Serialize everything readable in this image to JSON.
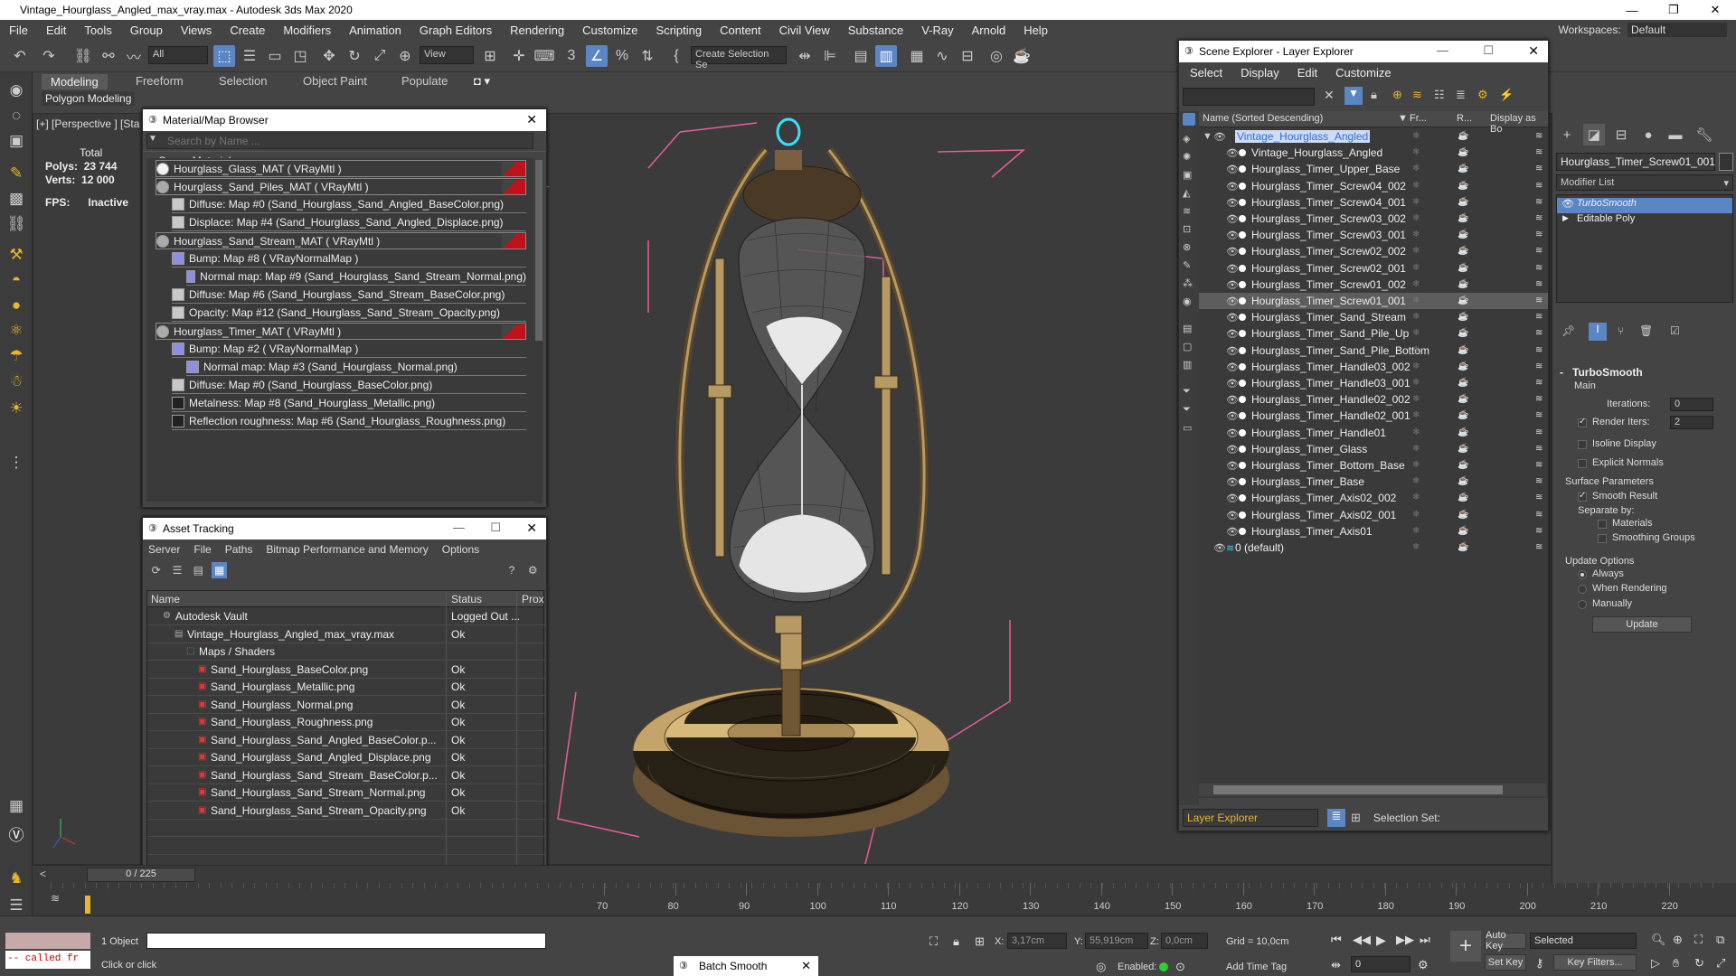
{
  "app": {
    "title": "Vintage_Hourglass_Angled_max_vray.max - Autodesk 3ds Max 2020",
    "workspaces_label": "Workspaces:",
    "workspace": "Default"
  },
  "menu": [
    "File",
    "Edit",
    "Tools",
    "Group",
    "Views",
    "Create",
    "Modifiers",
    "Animation",
    "Graph Editors",
    "Rendering",
    "Customize",
    "Scripting",
    "Content",
    "Civil View",
    "Substance",
    "V-Ray",
    "Arnold",
    "Help"
  ],
  "toolbar": {
    "filter": "All",
    "refcoord": "View",
    "selection_set": "Create Selection Se"
  },
  "ribbon": {
    "tabs": [
      "Modeling",
      "Freeform",
      "Selection",
      "Object Paint",
      "Populate"
    ],
    "subtab": "Polygon Modeling"
  },
  "viewport": {
    "label": "[+] [Perspective ] [Sta",
    "stats_total": "Total",
    "polys_label": "Polys:",
    "polys": "23 744",
    "verts_label": "Verts:",
    "verts": "12 000",
    "fps_label": "FPS:",
    "fps": "Inactive"
  },
  "material_browser": {
    "title": "Material/Map Browser",
    "search_placeholder": "Search by Name ...",
    "group": "- Scene Materials",
    "rows": [
      {
        "text": "Hourglass_Glass_MAT  ( VRayMtl )",
        "indent": 0,
        "mat": true
      },
      {
        "text": "Hourglass_Sand_Piles_MAT  ( VRayMtl )",
        "indent": 0,
        "mat": true
      },
      {
        "text": "Diffuse: Map #0 (Sand_Hourglass_Sand_Angled_BaseColor.png)",
        "indent": 1,
        "mat": false
      },
      {
        "text": "Displace: Map #4 (Sand_Hourglass_Sand_Angled_Displace.png)",
        "indent": 1,
        "mat": false
      },
      {
        "text": "Hourglass_Sand_Stream_MAT  ( VRayMtl )",
        "indent": 0,
        "mat": true
      },
      {
        "text": "Bump: Map #8  ( VRayNormalMap )",
        "indent": 1,
        "mat": false
      },
      {
        "text": "Normal map: Map #9 (Sand_Hourglass_Sand_Stream_Normal.png)",
        "indent": 2,
        "mat": false
      },
      {
        "text": "Diffuse: Map #6 (Sand_Hourglass_Sand_Stream_BaseColor.png)",
        "indent": 1,
        "mat": false
      },
      {
        "text": "Opacity: Map #12 (Sand_Hourglass_Sand_Stream_Opacity.png)",
        "indent": 1,
        "mat": false
      },
      {
        "text": "Hourglass_Timer_MAT  ( VRayMtl )",
        "indent": 0,
        "mat": true
      },
      {
        "text": "Bump: Map #2  ( VRayNormalMap )",
        "indent": 1,
        "mat": false
      },
      {
        "text": "Normal map: Map #3 (Sand_Hourglass_Normal.png)",
        "indent": 2,
        "mat": false
      },
      {
        "text": "Diffuse: Map #0 (Sand_Hourglass_BaseColor.png)",
        "indent": 1,
        "mat": false
      },
      {
        "text": "Metalness: Map #8 (Sand_Hourglass_Metallic.png)",
        "indent": 1,
        "mat": false
      },
      {
        "text": "Reflection roughness: Map #6 (Sand_Hourglass_Roughness.png)",
        "indent": 1,
        "mat": false
      }
    ]
  },
  "asset_tracking": {
    "title": "Asset Tracking",
    "menu": [
      "Server",
      "File",
      "Paths",
      "Bitmap Performance and Memory",
      "Options"
    ],
    "col_name": "Name",
    "col_status": "Status",
    "col_proxy": "Prox",
    "rows": [
      {
        "name": "Autodesk Vault",
        "status": "Logged Out ...",
        "indent": 1
      },
      {
        "name": "Vintage_Hourglass_Angled_max_vray.max",
        "status": "Ok",
        "indent": 2
      },
      {
        "name": "Maps / Shaders",
        "status": "",
        "indent": 3
      },
      {
        "name": "Sand_Hourglass_BaseColor.png",
        "status": "Ok",
        "indent": 4
      },
      {
        "name": "Sand_Hourglass_Metallic.png",
        "status": "Ok",
        "indent": 4
      },
      {
        "name": "Sand_Hourglass_Normal.png",
        "status": "Ok",
        "indent": 4
      },
      {
        "name": "Sand_Hourglass_Roughness.png",
        "status": "Ok",
        "indent": 4
      },
      {
        "name": "Sand_Hourglass_Sand_Angled_BaseColor.p...",
        "status": "Ok",
        "indent": 4
      },
      {
        "name": "Sand_Hourglass_Sand_Angled_Displace.png",
        "status": "Ok",
        "indent": 4
      },
      {
        "name": "Sand_Hourglass_Sand_Stream_BaseColor.p...",
        "status": "Ok",
        "indent": 4
      },
      {
        "name": "Sand_Hourglass_Sand_Stream_Normal.png",
        "status": "Ok",
        "indent": 4
      },
      {
        "name": "Sand_Hourglass_Sand_Stream_Opacity.png",
        "status": "Ok",
        "indent": 4
      }
    ]
  },
  "scene_explorer": {
    "title": "Scene Explorer - Layer Explorer",
    "menu": [
      "Select",
      "Display",
      "Edit",
      "Customize"
    ],
    "col_name": "Name (Sorted Descending)",
    "col_fr": "Fr...",
    "col_r": "R...",
    "col_display": "Display as Bo",
    "rows": [
      {
        "name": "Vintage_Hourglass_Angled",
        "level": 0,
        "root": true,
        "sel": false
      },
      {
        "name": "Vintage_Hourglass_Angled",
        "level": 1,
        "root": false,
        "sel": false
      },
      {
        "name": "Hourglass_Timer_Upper_Base",
        "level": 1,
        "root": false,
        "sel": false
      },
      {
        "name": "Hourglass_Timer_Screw04_002",
        "level": 1,
        "root": false,
        "sel": false
      },
      {
        "name": "Hourglass_Timer_Screw04_001",
        "level": 1,
        "root": false,
        "sel": false
      },
      {
        "name": "Hourglass_Timer_Screw03_002",
        "level": 1,
        "root": false,
        "sel": false
      },
      {
        "name": "Hourglass_Timer_Screw03_001",
        "level": 1,
        "root": false,
        "sel": false
      },
      {
        "name": "Hourglass_Timer_Screw02_002",
        "level": 1,
        "root": false,
        "sel": false
      },
      {
        "name": "Hourglass_Timer_Screw02_001",
        "level": 1,
        "root": false,
        "sel": false
      },
      {
        "name": "Hourglass_Timer_Screw01_002",
        "level": 1,
        "root": false,
        "sel": false
      },
      {
        "name": "Hourglass_Timer_Screw01_001",
        "level": 1,
        "root": false,
        "sel": true
      },
      {
        "name": "Hourglass_Timer_Sand_Stream",
        "level": 1,
        "root": false,
        "sel": false
      },
      {
        "name": "Hourglass_Timer_Sand_Pile_Up",
        "level": 1,
        "root": false,
        "sel": false
      },
      {
        "name": "Hourglass_Timer_Sand_Pile_Bottom",
        "level": 1,
        "root": false,
        "sel": false
      },
      {
        "name": "Hourglass_Timer_Handle03_002",
        "level": 1,
        "root": false,
        "sel": false
      },
      {
        "name": "Hourglass_Timer_Handle03_001",
        "level": 1,
        "root": false,
        "sel": false
      },
      {
        "name": "Hourglass_Timer_Handle02_002",
        "level": 1,
        "root": false,
        "sel": false
      },
      {
        "name": "Hourglass_Timer_Handle02_001",
        "level": 1,
        "root": false,
        "sel": false
      },
      {
        "name": "Hourglass_Timer_Handle01",
        "level": 1,
        "root": false,
        "sel": false
      },
      {
        "name": "Hourglass_Timer_Glass",
        "level": 1,
        "root": false,
        "sel": false
      },
      {
        "name": "Hourglass_Timer_Bottom_Base",
        "level": 1,
        "root": false,
        "sel": false
      },
      {
        "name": "Hourglass_Timer_Base",
        "level": 1,
        "root": false,
        "sel": false
      },
      {
        "name": "Hourglass_Timer_Axis02_002",
        "level": 1,
        "root": false,
        "sel": false
      },
      {
        "name": "Hourglass_Timer_Axis02_001",
        "level": 1,
        "root": false,
        "sel": false
      },
      {
        "name": "Hourglass_Timer_Axis01",
        "level": 1,
        "root": false,
        "sel": false
      },
      {
        "name": "0 (default)",
        "level": 0,
        "root": false,
        "sel": false
      }
    ],
    "layer_explorer": "Layer Explorer",
    "selection_set_label": "Selection Set:"
  },
  "command_panel": {
    "object_name": "Hourglass_Timer_Screw01_001",
    "modifier_list": "Modifier List",
    "stack": [
      "TurboSmooth",
      "Editable Poly"
    ],
    "turbosmooth_title": "TurboSmooth",
    "main_label": "Main",
    "iterations_label": "Iterations:",
    "iterations": "0",
    "render_iters_label": "Render Iters:",
    "render_iters": "2",
    "isoline": "Isoline Display",
    "explicit_normals": "Explicit Normals",
    "surface_params": "Surface Parameters",
    "smooth_result": "Smooth Result",
    "separate_by": "Separate by:",
    "materials": "Materials",
    "smoothing_groups": "Smoothing Groups",
    "update_options": "Update Options",
    "always": "Always",
    "when_rendering": "When Rendering",
    "manually": "Manually",
    "update_button": "Update"
  },
  "timeline": {
    "slider": "0 / 225",
    "ticks": [
      "70",
      "80",
      "90",
      "100",
      "110",
      "120",
      "130",
      "140",
      "150",
      "160",
      "170",
      "180",
      "190",
      "200",
      "210",
      "220"
    ]
  },
  "status": {
    "objects": "1 Object",
    "prompt": "Click or click",
    "listener": "-- called fr",
    "x_label": "X:",
    "x": "3,17cm",
    "y_label": "Y:",
    "y": "55,919cm",
    "z_label": "Z:",
    "z": "0,0cm",
    "grid": "Grid = 10,0cm",
    "enabled_label": "Enabled:",
    "add_time_tag": "Add Time Tag",
    "frame": "0",
    "auto_key": "Auto Key",
    "set_key": "Set Key",
    "selected": "Selected",
    "key_filters": "Key Filters...",
    "batch_smooth": "Batch Smooth"
  }
}
